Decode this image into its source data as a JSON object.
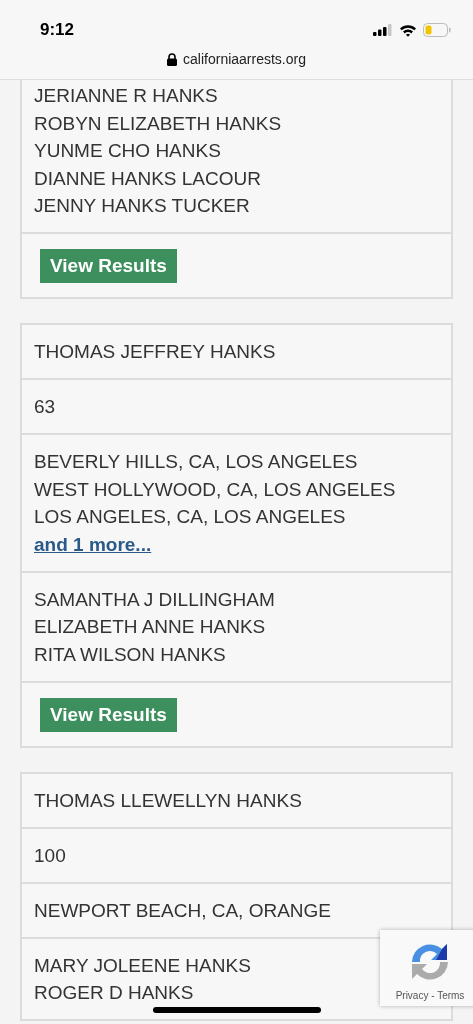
{
  "status_bar": {
    "time": "9:12"
  },
  "address_bar": {
    "url": "californiaarrests.org"
  },
  "results": [
    {
      "relatives": [
        "JERIANNE R HANKS",
        "ROBYN ELIZABETH HANKS",
        "YUNME CHO HANKS",
        "DIANNE HANKS LACOUR",
        "JENNY HANKS TUCKER"
      ],
      "button": "View Results"
    },
    {
      "name": "THOMAS JEFFREY HANKS",
      "age": "63",
      "locations": [
        "BEVERLY HILLS, CA, LOS ANGELES",
        "WEST HOLLYWOOD, CA, LOS ANGELES",
        "LOS ANGELES, CA, LOS ANGELES"
      ],
      "more_link": "and 1 more...",
      "relatives": [
        "SAMANTHA J DILLINGHAM",
        "ELIZABETH ANNE HANKS",
        "RITA WILSON HANKS"
      ],
      "button": "View Results"
    },
    {
      "name": "THOMAS LLEWELLYN HANKS",
      "age": "100",
      "locations": [
        "NEWPORT BEACH, CA, ORANGE"
      ],
      "relatives": [
        "MARY JOLEENE HANKS",
        "ROGER D HANKS"
      ]
    }
  ],
  "recaptcha": {
    "links": "Privacy - Terms"
  }
}
